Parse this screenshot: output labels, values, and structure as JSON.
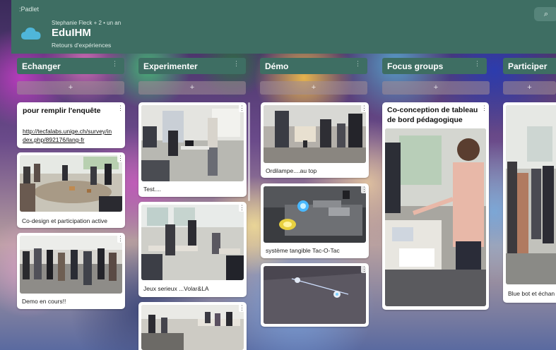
{
  "app": {
    "brand": ":Padlet"
  },
  "header": {
    "author_line": "Stephanie Fleck + 2 • un an",
    "title": "EduIHM",
    "subtitle": "Retours d'expériences",
    "search_icon_glyph": "⌕",
    "icon": "cloud-icon"
  },
  "colors": {
    "header_bg": "#3e6e63",
    "cloud_icon": "#4fb6d9"
  },
  "columns": [
    {
      "title": "Echanger",
      "menu": "⋮",
      "add": "+"
    },
    {
      "title": "Experimenter",
      "menu": "⋮",
      "add": "+"
    },
    {
      "title": "Démo",
      "menu": "⋮",
      "add": "+"
    },
    {
      "title": "Focus groups",
      "menu": "⋮",
      "add": "+"
    },
    {
      "title": "Participer",
      "menu": "⋮",
      "add": "+"
    }
  ],
  "cards": {
    "echanger": [
      {
        "title": "pour remplir l'enquête",
        "link": "http://tecfalabs.unige.ch/survey/index.php/892176/lang-fr",
        "link_line1": "http://tecfalabs.unige.ch/survey/in",
        "link_line2": "dex.php/892176/lang-fr"
      },
      {
        "caption": "Co-design et participation active"
      },
      {
        "caption": "Demo en cours!!"
      }
    ],
    "experimenter": [
      {
        "caption": "Test...."
      },
      {
        "caption": "Jeux serieux ...Volar&LA"
      },
      {
        "caption": ""
      }
    ],
    "demo": [
      {
        "caption": "Ordilampe....au top"
      },
      {
        "caption": "système tangible Tac-O-Tac"
      },
      {
        "caption": ""
      }
    ],
    "focus": [
      {
        "title_line1": "Co-conception de tableau",
        "title_line2": "de bord pédagogique"
      }
    ],
    "participer": [
      {
        "caption": "Blue bot et échan"
      }
    ]
  },
  "card_menu_glyph": "⋮"
}
